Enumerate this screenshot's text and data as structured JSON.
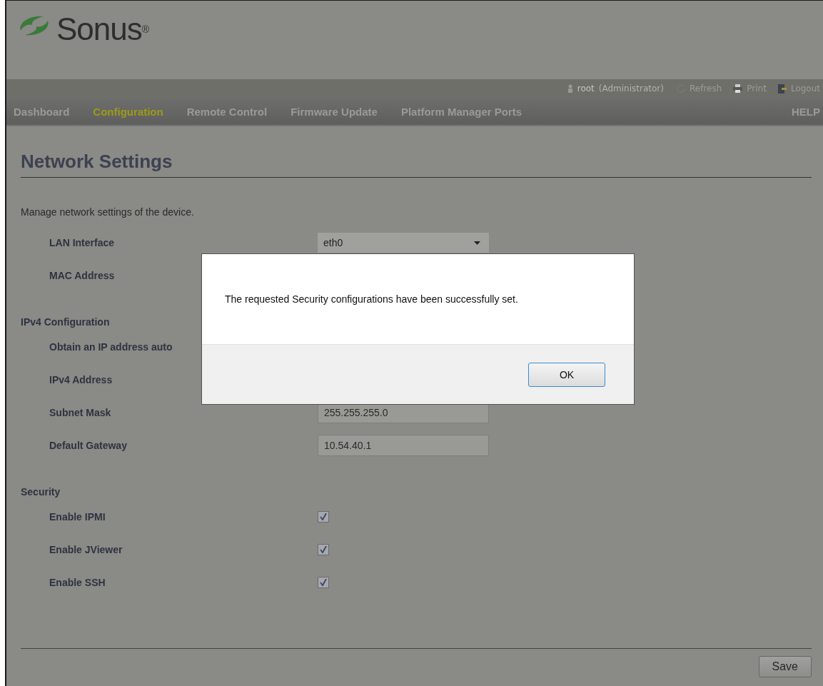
{
  "header": {
    "logo": "Sonus$^{®}$"
  },
  "user_bar": {
    "user": "root",
    "role": "(Administrator)",
    "links": [
      {
        "kind": "refresh",
        "label": "Refresh"
      },
      {
        "kind": "print",
        "label": "Print"
      },
      {
        "kind": "logout",
        "label": "Logout"
      }
    ]
  },
  "nav": {
    "items": [
      {
        "label": "Dashboard",
        "selected": false
      },
      {
        "label": "Configuration",
        "selected": true
      },
      {
        "label": "Remote Control",
        "selected": false
      },
      {
        "label": "Firmware Update",
        "selected": false
      },
      {
        "label": "Platform Manager Ports",
        "selected": false
      }
    ],
    "help": "HELP"
  },
  "page": {
    "title": "Network Settings",
    "description": "Manage network settings of the device.",
    "sections": [
      {
        "fields": [
          {
            "kind": "select",
            "label": "LAN Interface",
            "value": "eth0"
          },
          {
            "kind": "label",
            "label": "MAC Address"
          }
        ]
      },
      {
        "heading": "IPv4 Configuration",
        "fields": [
          {
            "kind": "label",
            "label": "Obtain an IP address auto"
          },
          {
            "kind": "label",
            "label": "IPv4 Address"
          },
          {
            "kind": "text",
            "label": "Subnet Mask",
            "value": "255.255.255.0"
          },
          {
            "kind": "text",
            "label": "Default Gateway",
            "value": "10.54.40.1"
          }
        ]
      },
      {
        "heading": "Security",
        "fields": [
          {
            "kind": "checkbox",
            "label": "Enable IPMI",
            "checked": true
          },
          {
            "kind": "checkbox",
            "label": "Enable JViewer",
            "checked": true
          },
          {
            "kind": "checkbox",
            "label": "Enable SSH",
            "checked": true
          }
        ]
      }
    ],
    "save": "Save"
  },
  "dialog": {
    "message": "The requested Security configurations have been successfully set.",
    "button": "OK"
  }
}
